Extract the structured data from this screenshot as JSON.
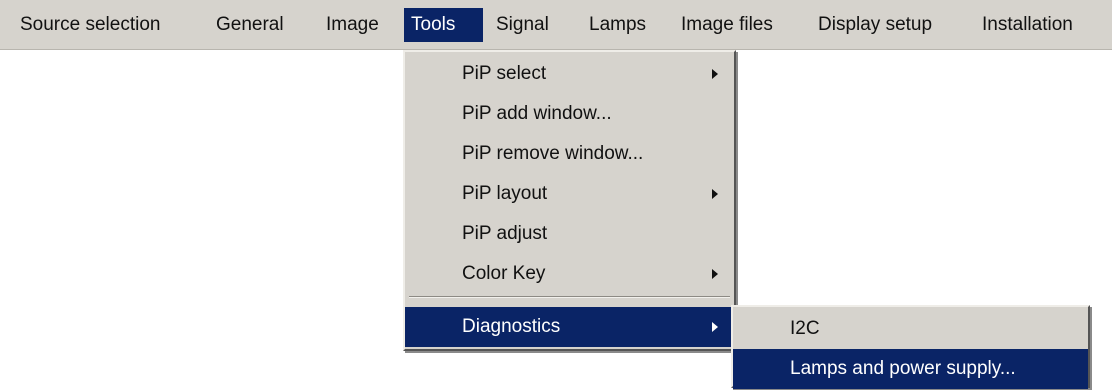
{
  "menubar": {
    "items": [
      {
        "label": "Source selection"
      },
      {
        "label": "General"
      },
      {
        "label": "Image"
      },
      {
        "label": "Tools"
      },
      {
        "label": "Signal"
      },
      {
        "label": "Lamps"
      },
      {
        "label": "Image files"
      },
      {
        "label": "Display setup"
      },
      {
        "label": "Installation"
      }
    ]
  },
  "tools_menu": {
    "items": [
      {
        "label": "PiP select",
        "has_submenu": true
      },
      {
        "label": "PiP add window...",
        "has_submenu": false
      },
      {
        "label": "PiP remove window...",
        "has_submenu": false
      },
      {
        "label": "PiP layout",
        "has_submenu": true
      },
      {
        "label": "PiP adjust",
        "has_submenu": false
      },
      {
        "label": "Color Key",
        "has_submenu": true
      },
      {
        "label": "Diagnostics",
        "has_submenu": true,
        "highlighted": true
      }
    ]
  },
  "diagnostics_menu": {
    "items": [
      {
        "label": "I2C"
      },
      {
        "label": "Lamps and power supply...",
        "highlighted": true
      }
    ]
  },
  "colors": {
    "menu_background": "#d6d3cd",
    "highlight": "#0a2466",
    "highlight_text": "#ffffff",
    "text": "#111111"
  }
}
